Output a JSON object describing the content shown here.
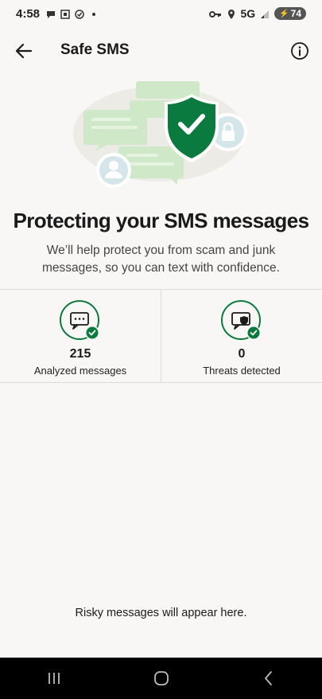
{
  "status_bar": {
    "time": "4:58",
    "network": "5G",
    "battery": "74",
    "left_icons": [
      "chat-bubble-icon",
      "screenshot-icon",
      "check-circle-icon",
      "dot-icon"
    ],
    "right_icons": [
      "key-icon",
      "location-icon",
      "signal-icon",
      "battery-icon"
    ]
  },
  "header": {
    "title": "Safe SMS",
    "back_icon": "arrow-left-icon",
    "info_icon": "info-icon"
  },
  "hero": {
    "headline": "Protecting your SMS messages",
    "description": "We’ll help protect you from scam and junk messages, so you can text with confidence."
  },
  "stats": [
    {
      "value": "215",
      "label": "Analyzed messages",
      "icon": "message-check-icon"
    },
    {
      "value": "0",
      "label": "Threats detected",
      "icon": "shield-message-check-icon"
    }
  ],
  "empty_state": "Risky messages will appear here.",
  "colors": {
    "background": "#f8f7f5",
    "brand_green": "#0b7a3e",
    "illustration_green": "#cfe8c7",
    "text": "#1a1a1a"
  }
}
